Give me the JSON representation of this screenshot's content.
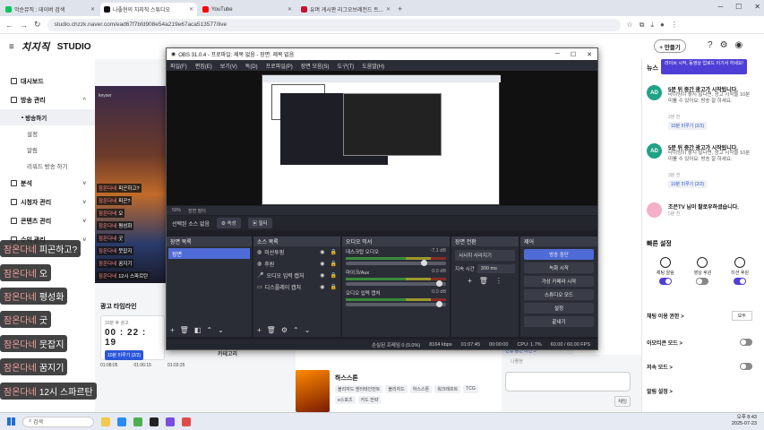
{
  "browser": {
    "tabs": [
      {
        "label": "악순뮤직 : 데이버 검색",
        "color": "#03c75a",
        "active": false
      },
      {
        "label": "나좋현의 치지직 스튜디오",
        "color": "#111111",
        "active": true
      },
      {
        "label": "YouTube",
        "color": "#ff0000",
        "active": false
      },
      {
        "label": "유머 게시판 리그오브레전드 트...",
        "color": "#c8102e",
        "active": false
      }
    ],
    "url": "studio.chzzk.naver.com/ead67f7bfd908e54a219e67aca513577/live"
  },
  "site": {
    "logo": "치지직",
    "studio": "STUDIO",
    "make_button": "+ 만들기"
  },
  "sidebar": {
    "items": [
      {
        "label": "대시보드",
        "type": "item"
      },
      {
        "label": "방송 관리",
        "type": "item",
        "chev": "^"
      },
      {
        "label": "방송하기",
        "type": "sub",
        "active": true
      },
      {
        "label": "설정",
        "type": "sub"
      },
      {
        "label": "알림",
        "type": "sub"
      },
      {
        "label": "리워드 방송 하기",
        "type": "sub"
      },
      {
        "label": "분석",
        "type": "item",
        "chev": "v"
      },
      {
        "label": "시청자 관리",
        "type": "item",
        "chev": "v"
      },
      {
        "label": "콘텐츠 관리",
        "type": "item",
        "chev": "v"
      },
      {
        "label": "수익 관리",
        "type": "item",
        "chev": "v"
      }
    ]
  },
  "preview": {
    "label": "keyser"
  },
  "overlay_chat": [
    {
      "nick": "잠온다네",
      "msg": "피곤하고?"
    },
    {
      "nick": "잠온다네",
      "msg": "오"
    },
    {
      "nick": "잠온다네",
      "msg": "평성화"
    },
    {
      "nick": "잠온다네",
      "msg": "굿"
    },
    {
      "nick": "잠온다네",
      "msg": "뭇잡지"
    },
    {
      "nick": "잠온다네",
      "msg": "꿈지기"
    },
    {
      "nick": "잠온다네",
      "msg": "12시 스파르탄"
    }
  ],
  "small_chat": [
    {
      "nick": "잠온다네",
      "msg": "피곤하고?"
    },
    {
      "nick": "잠온다네",
      "msg": "피곤?"
    },
    {
      "nick": "잠온다네",
      "msg": "오"
    },
    {
      "nick": "잠온다네",
      "msg": "평성화"
    },
    {
      "nick": "잠온다네",
      "msg": "굿"
    },
    {
      "nick": "잠온다네",
      "msg": "뭇잡지"
    },
    {
      "nick": "잠온다네",
      "msg": "꿈지기"
    },
    {
      "nick": "잠온다네",
      "msg": "12시 스파르탄"
    }
  ],
  "ad": {
    "title": "광고 타임라인",
    "next_label": "10분 후 광고",
    "time": "00 : 22 : 19",
    "btn": "10분 미루기 (2/2)",
    "timeline": [
      "01:08:05",
      "01:06:15",
      "01:03:25"
    ]
  },
  "category": {
    "label": "카테고리",
    "game_title": "하스스톤",
    "tags": [
      "블리자드 엔터테인먼트",
      "블리자드",
      "하스스톤",
      "워크래프트",
      "TCG",
      "e스포츠",
      "카드 전략"
    ]
  },
  "obs": {
    "title": "OBS 31.0.4 - 프로파일: 제목 없음 - 장면: 제목 없음",
    "menu": [
      "파일(F)",
      "편집(E)",
      "보기(V)",
      "독(D)",
      "프로파일(P)",
      "장면 모음(S)",
      "도구(T)",
      "도움말(H)"
    ],
    "prev_bar": [
      "50%",
      "장면 필터"
    ],
    "src_bar": {
      "no_source": "선택된 소스 없음",
      "props": "속성",
      "filters": "필터"
    },
    "docks": {
      "scenes": "장면 목록",
      "sources": "소스 목록",
      "mixer": "오디오 믹서",
      "transitions": "장면 전환",
      "controls": "제어"
    },
    "scene_items": [
      "장면"
    ],
    "source_items": [
      "미산투핑",
      "후원",
      "오디오 입력 캡처",
      "디스플레이 캡처"
    ],
    "mixer_items": [
      {
        "name": "데스크탑 오디오",
        "db": "-7.1 dB"
      },
      {
        "name": "마이크/Aux",
        "db": "0.0 dB"
      },
      {
        "name": "오디오 입력 캡처",
        "db": "0.0 dB"
      }
    ],
    "transition": {
      "type": "서서히 사라지기",
      "duration_label": "지속 시간",
      "duration": "300 ms"
    },
    "controls": [
      "방송 중단",
      "녹화 시작",
      "가상 카메라 시작",
      "스튜디오 모드",
      "설정",
      "끝내기"
    ],
    "status": [
      "손실된 프레임 0 (0.0%)",
      "8164 kbps",
      "01:07:45",
      "00:00:00",
      "CPU: 1.7%",
      "60.00 / 60.00 FPS"
    ]
  },
  "right": {
    "news_title": "뉴스",
    "popup": "라이브 시작, 동영상 업로드 이기서 하세요!",
    "news": [
      {
        "avatar": "AD",
        "title": "5분 뒤 중간 광고가 시작됩니다.",
        "desc": "타이밍이 좋지 않다면, 광고 시작을 10분 미룰 수 있어요. 방송 잘 하세요.",
        "ago": "2분 전",
        "btn": "10분 미루기 (2/2)"
      },
      {
        "avatar": "AD",
        "title": "5분 뒤 중간 광고가 시작됩니다.",
        "desc": "타이밍이 좋지 않다면, 광고 시작을 10분 미룰 수 있어요. 방송 잘 하세요.",
        "ago": "3분 전",
        "btn": "10분 미루기 (2/2)"
      },
      {
        "avatar": "",
        "title": "조은TV 님이 팔로우하셨습니다.",
        "desc": "",
        "ago": "5분 전",
        "btn": ""
      }
    ],
    "quick_title": "빠른 설정",
    "quick_icons": [
      "채팅 알림",
      "영상 후원",
      "미션 후원"
    ],
    "settings": [
      {
        "label": "채팅 이용 권한 >",
        "value": "모두",
        "kind": "select"
      },
      {
        "label": "이모티콘 모드 >",
        "kind": "toggle"
      },
      {
        "label": "저속 모드 >",
        "kind": "toggle"
      },
      {
        "label": "알림 설정 >",
        "kind": "none"
      }
    ],
    "chat_send": "채팅",
    "now_playing": "나좋현",
    "strip": "진행 중인 미션 5"
  },
  "taskbar": {
    "search": "검색",
    "clock_time": "오후 8:43",
    "clock_date": "2025-07-23"
  }
}
